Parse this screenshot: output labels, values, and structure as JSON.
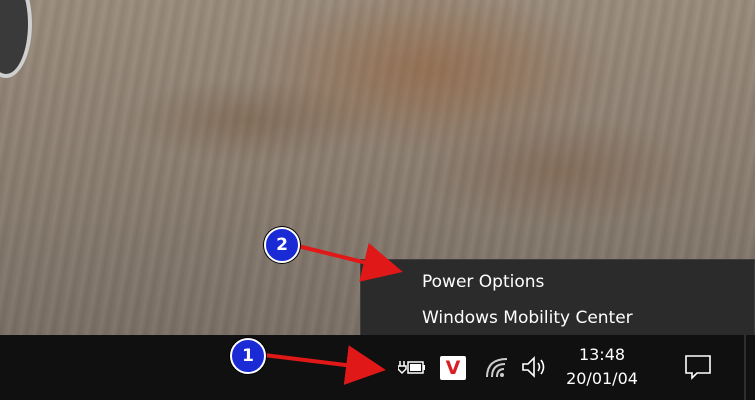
{
  "context_menu": {
    "items": [
      {
        "label": "Power Options"
      },
      {
        "label": "Windows Mobility Center"
      }
    ]
  },
  "taskbar": {
    "clock": {
      "time": "13:48",
      "date": "20/01/04"
    },
    "tray_icons": [
      "battery-icon",
      "antivirus-v-icon",
      "wifi-icon",
      "volume-icon"
    ],
    "v_icon_letter": "V",
    "notification_icon": "action-center-icon"
  },
  "annotations": [
    {
      "number": "1"
    },
    {
      "number": "2"
    }
  ],
  "colors": {
    "taskbar": "#101010",
    "menu_bg": "#2b2b2b",
    "annotation_circle": "#1a2bd6",
    "annotation_arrow": "#e01818",
    "v_icon": "#d81f26"
  }
}
